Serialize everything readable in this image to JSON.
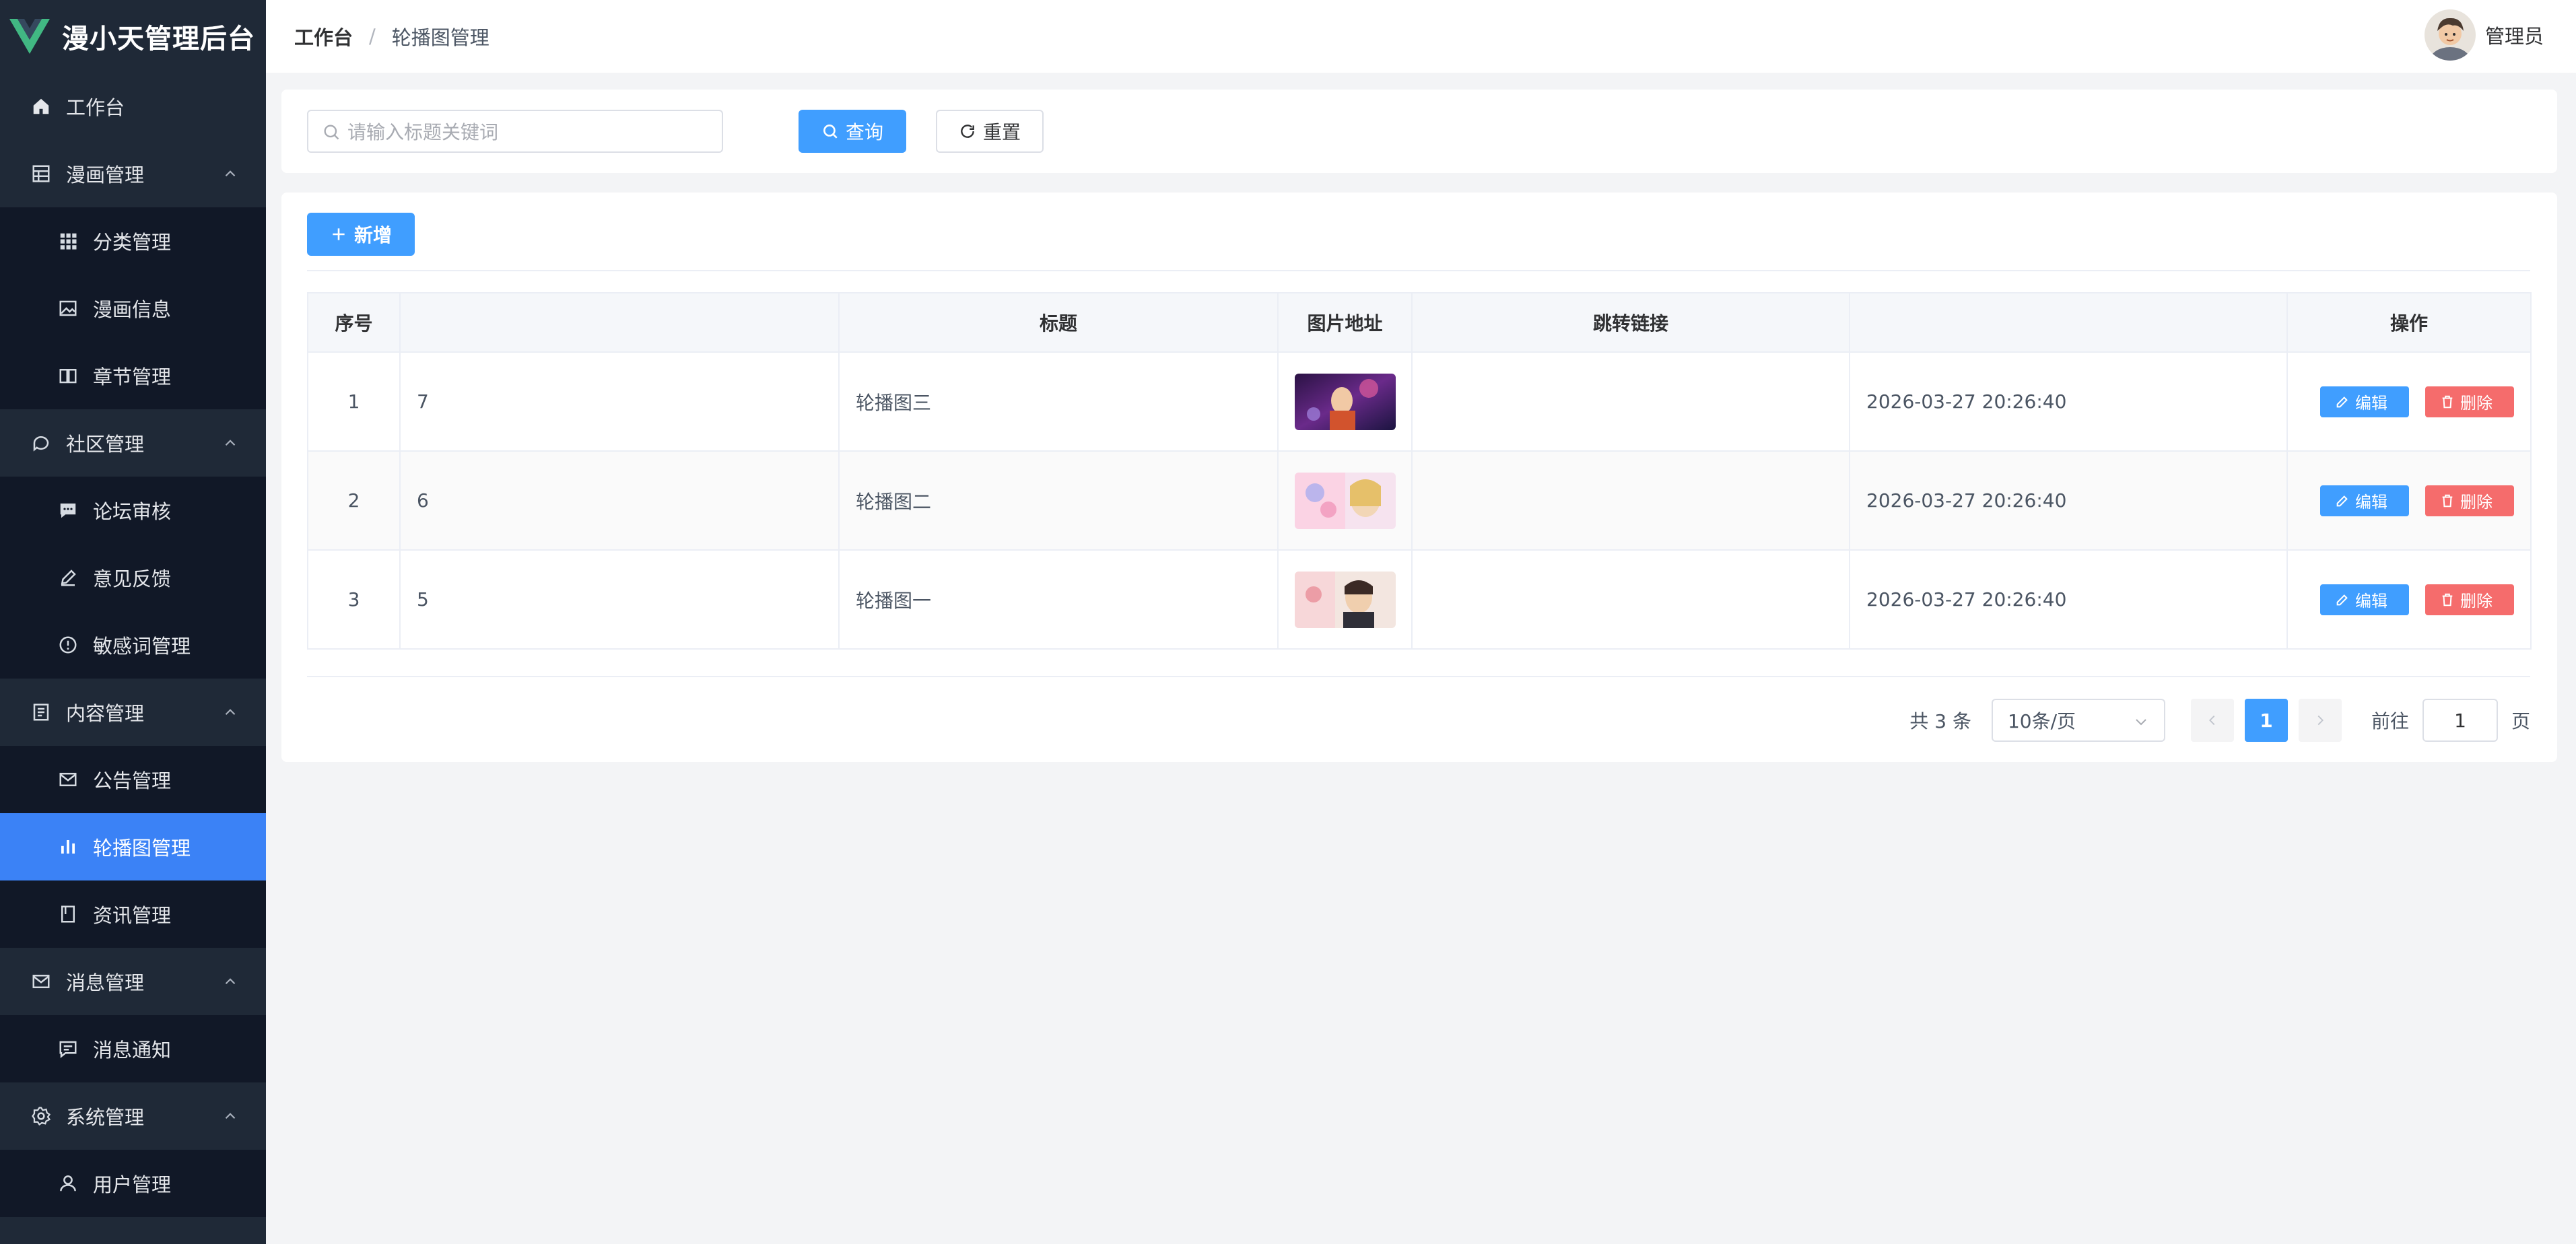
{
  "app": {
    "title": "漫小天管理后台",
    "brand_color": "#41b883",
    "accent": "#409eff",
    "danger": "#f56c6c",
    "sidebar_bg": "#1f2937",
    "active_bg": "#3b82f6"
  },
  "sidebar": {
    "items": [
      {
        "label": "工作台",
        "icon": "home-icon",
        "kind": "top"
      },
      {
        "label": "漫画管理",
        "icon": "table-icon",
        "kind": "group"
      },
      {
        "label": "分类管理",
        "icon": "grid-icon",
        "kind": "sub"
      },
      {
        "label": "漫画信息",
        "icon": "picture-icon",
        "kind": "sub"
      },
      {
        "label": "章节管理",
        "icon": "book-icon",
        "kind": "sub"
      },
      {
        "label": "社区管理",
        "icon": "chat-icon",
        "kind": "group"
      },
      {
        "label": "论坛审核",
        "icon": "chat-dots-icon",
        "kind": "sub"
      },
      {
        "label": "意见反馈",
        "icon": "edit-pen-icon",
        "kind": "sub"
      },
      {
        "label": "敏感词管理",
        "icon": "warning-icon",
        "kind": "sub"
      },
      {
        "label": "内容管理",
        "icon": "document-icon",
        "kind": "group"
      },
      {
        "label": "公告管理",
        "icon": "mail-icon",
        "kind": "sub"
      },
      {
        "label": "轮播图管理",
        "icon": "bar-chart-icon",
        "kind": "sub",
        "active": true
      },
      {
        "label": "资讯管理",
        "icon": "notebook-icon",
        "kind": "sub"
      },
      {
        "label": "消息管理",
        "icon": "mail-icon",
        "kind": "group"
      },
      {
        "label": "消息通知",
        "icon": "message-icon",
        "kind": "sub"
      },
      {
        "label": "系统管理",
        "icon": "gear-icon",
        "kind": "group"
      },
      {
        "label": "用户管理",
        "icon": "user-icon",
        "kind": "sub"
      }
    ]
  },
  "header": {
    "breadcrumb_home": "工作台",
    "breadcrumb_sep": "/",
    "breadcrumb_current": "轮播图管理",
    "user_name": "管理员"
  },
  "search": {
    "placeholder": "请输入标题关键词",
    "query_label": "查询",
    "reset_label": "重置"
  },
  "toolbar": {
    "add_label": "新增"
  },
  "table": {
    "columns": [
      "序号",
      "",
      "标题",
      "图片地址",
      "跳转链接",
      "",
      "操作"
    ],
    "rows": [
      {
        "index": "1",
        "id": "7",
        "title": "轮播图三",
        "link": "",
        "time": "2026-03-27 20:26:40"
      },
      {
        "index": "2",
        "id": "6",
        "title": "轮播图二",
        "link": "",
        "time": "2026-03-27 20:26:40"
      },
      {
        "index": "3",
        "id": "5",
        "title": "轮播图一",
        "link": "",
        "time": "2026-03-27 20:26:40"
      }
    ],
    "edit_label": "编辑",
    "delete_label": "删除"
  },
  "pagination": {
    "total_text": "共 3 条",
    "page_size": "10条/页",
    "current_page": "1",
    "goto_label": "前往",
    "goto_value": "1",
    "page_suffix": "页"
  }
}
